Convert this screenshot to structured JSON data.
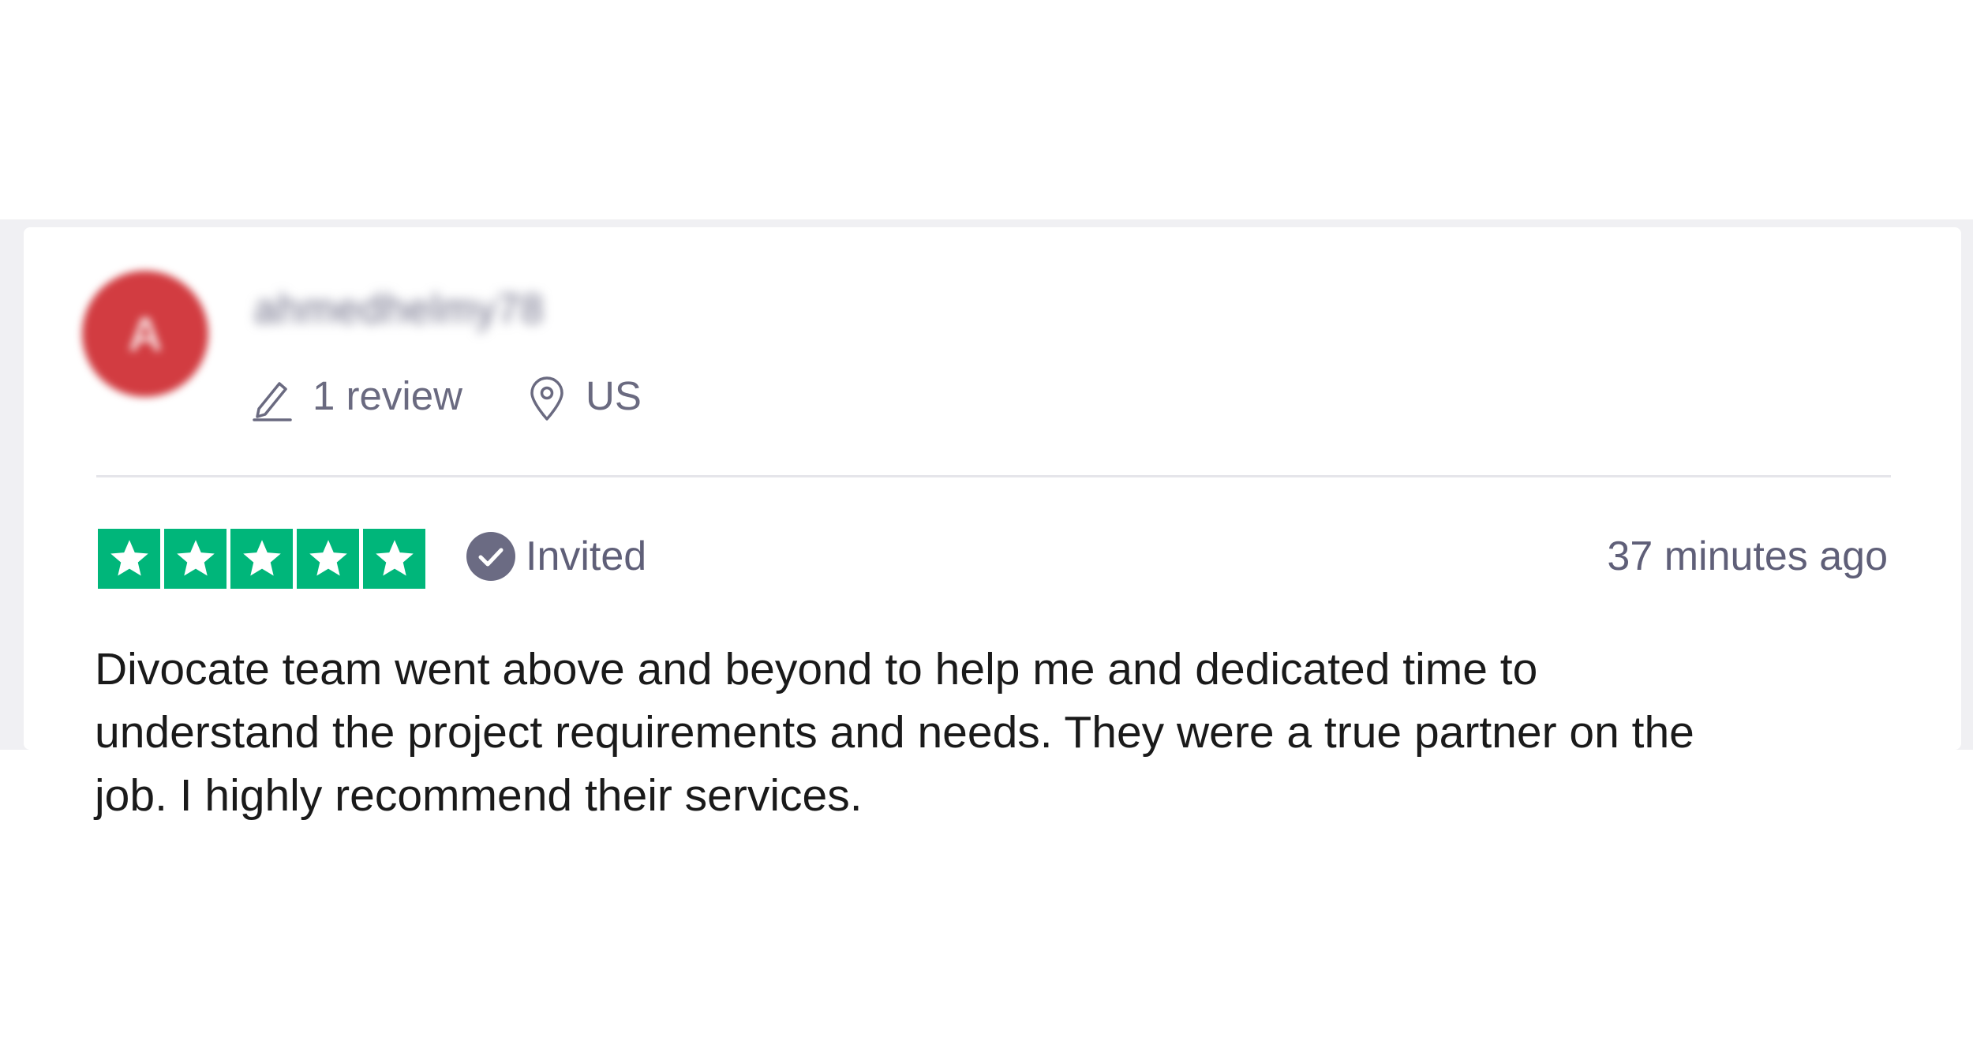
{
  "reviewer": {
    "avatar_letter": "A",
    "username": "ahmedhelmy78",
    "review_count": "1 review",
    "location": "US"
  },
  "rating": {
    "stars": 5,
    "max_stars": 5,
    "star_color": "#00b67a"
  },
  "status": {
    "invited_label": "Invited"
  },
  "timestamp": "37 minutes ago",
  "review_text": "Divocate team went above and beyond to help me and dedicated time to understand the project requirements and needs. They were a true partner on the job. I highly recommend their services.",
  "colors": {
    "avatar": "#d23c41",
    "muted_text": "#6a6a80",
    "body_text": "#1a1a1a",
    "badge": "#6b6b83"
  },
  "icons": {
    "review": "pencil-icon",
    "location": "location-pin-icon",
    "invited": "verified-check-icon",
    "star": "star-icon"
  }
}
